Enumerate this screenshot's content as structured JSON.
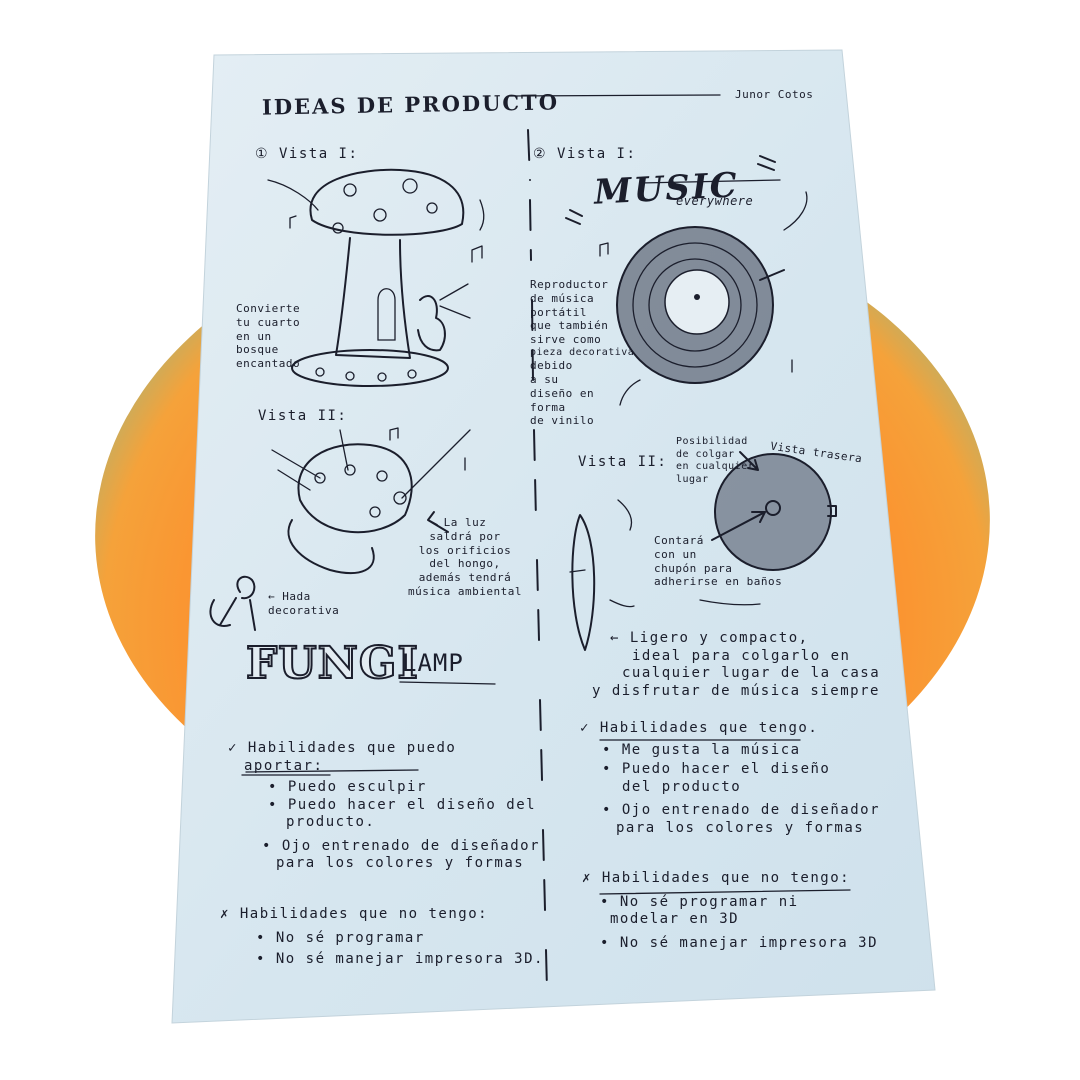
{
  "header": {
    "title": "IDEAS DE PRODUCTO",
    "author": "Junor Cotos"
  },
  "left": {
    "vista1": "① Vista I:",
    "caption1": [
      "Convierte",
      "tu cuarto",
      "en un",
      "bosque",
      "encantado"
    ],
    "vista2": "Vista II:",
    "light_note": [
      "La luz",
      "saldrá por",
      "los orificios",
      "del hongo,",
      "además tendrá",
      "música ambiental"
    ],
    "fairy_note": [
      "← Hada",
      "decorativa"
    ],
    "logo_word": "FUNGI",
    "logo_suffix": "LAMP",
    "skills_heading": [
      "✓ Habilidades que puedo",
      "aportar:"
    ],
    "skills": [
      "• Puedo esculpir",
      "• Puedo hacer el diseño del",
      "producto.",
      "• Ojo entrenado de diseñador",
      "para los colores y formas"
    ],
    "noskills_heading": "✗ Habilidades que no tengo:",
    "noskills": [
      "• No sé programar",
      "• No sé manejar impresora 3D."
    ]
  },
  "right": {
    "vista1": "② Vista I:",
    "logo_word": "MUSIC",
    "logo_tag": "everywhere",
    "caption1": [
      "Reproductor",
      "de música",
      "portátil",
      "que también",
      "sirve como",
      "pieza decorativa",
      "debido",
      "a su",
      "diseño en",
      "forma",
      "de vinilo"
    ],
    "vista2": "Vista II:",
    "hang_note": [
      "Posibilidad",
      "de colgar",
      "en cualquier",
      "lugar"
    ],
    "back_note": "Vista trasera",
    "suction_note": [
      "Contará",
      "con un",
      "chupón para",
      "adherirse en baños"
    ],
    "light_note": [
      "← Ligero y compacto,",
      "ideal para colgarlo en",
      "cualquier lugar de la casa",
      "y disfrutar de música siempre"
    ],
    "skills_heading": "✓ Habilidades que tengo.",
    "skills": [
      "• Me gusta la música",
      "• Puedo hacer el diseño",
      "del producto",
      "• Ojo entrenado de diseñador",
      "para los colores y formas"
    ],
    "noskills_heading": "✗ Habilidades que no tengo:",
    "noskills": [
      "• No sé programar ni",
      "modelar en 3D",
      "• No sé manejar impresora 3D"
    ]
  },
  "colors": {
    "paper": "#dbe9f1",
    "ink": "#1b1e2c",
    "orange": "#ff7a1a",
    "teal": "#36b8b8"
  }
}
